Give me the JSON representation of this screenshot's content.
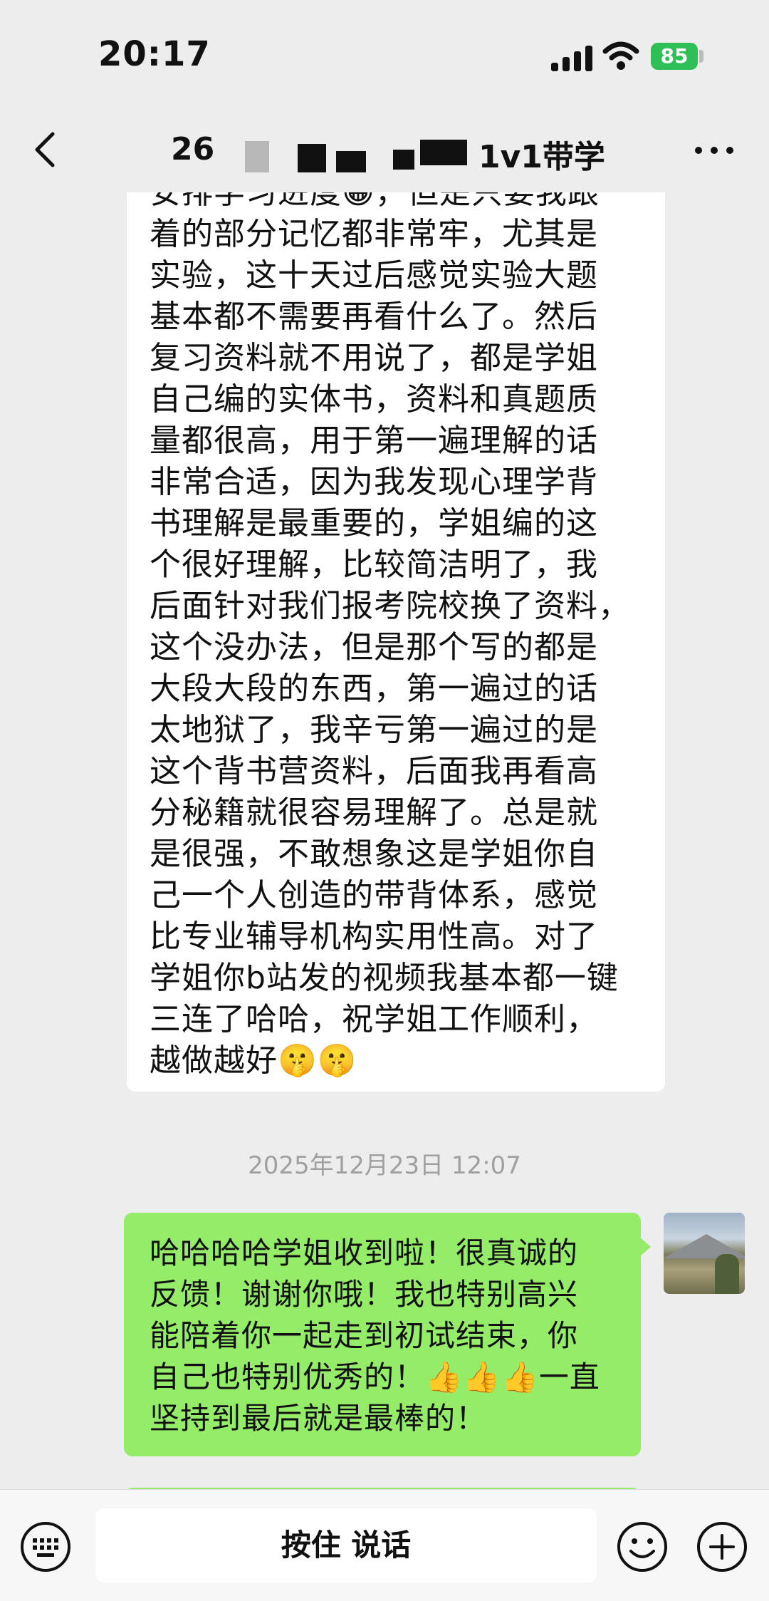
{
  "status_bar": {
    "time": "20:17",
    "battery": "85"
  },
  "header": {
    "title_prefix": "26",
    "title_suffix": "1v1带学"
  },
  "messages": {
    "received_text": "安排学习进度😀，但是只要我跟\n着的部分记忆都非常牢，尤其是\n实验，这十天过后感觉实验大题\n基本都不需要再看什么了。然后\n复习资料就不用说了，都是学姐\n自己编的实体书，资料和真题质\n量都很高，用于第一遍理解的话\n非常合适，因为我发现心理学背\n书理解是最重要的，学姐编的这\n个很好理解，比较简洁明了，我\n后面针对我们报考院校换了资料，\n这个没办法，但是那个写的都是\n大段大段的东西，第一遍过的话\n太地狱了，我辛亏第一遍过的是\n这个背书营资料，后面我再看高\n分秘籍就很容易理解了。总是就\n是很强，不敢想象这是学姐你自\n己一个人创造的带背体系，感觉\n比专业辅导机构实用性高。对了\n学姐你b站发的视频我基本都一键\n三连了哈哈，祝学姐工作顺利，\n越做越好🤫🤫",
    "timestamp": "2025年12月23日 12:07",
    "sent_text": "哈哈哈哈学姐收到啦！很真诚的\n反馈！谢谢你哦！我也特别高兴\n能陪着你一起走到初试结束，你\n自己也特别优秀的！👍👍👍一直\n坚持到最后就是最棒的！"
  },
  "input_bar": {
    "hold_to_talk_label": "按住 说话"
  },
  "colors": {
    "background": "#ededed",
    "sent_bubble": "#95ec69",
    "received_bubble": "#ffffff",
    "battery": "#2fbf57"
  },
  "icons": [
    "back-arrow-icon",
    "more-icon",
    "keyboard-icon",
    "emoji-icon",
    "plus-icon",
    "signal-icon",
    "wifi-icon"
  ]
}
